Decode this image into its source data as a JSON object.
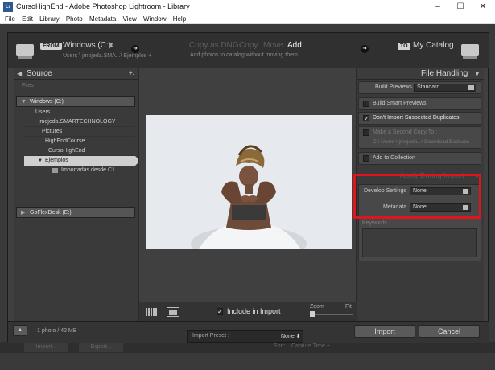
{
  "window": {
    "app_icon": "Lr",
    "title": "CursoHighEnd - Adobe Photoshop Lightroom - Library",
    "controls": {
      "minimize": "–",
      "maximize": "☐",
      "close": "✕"
    }
  },
  "menu": [
    "File",
    "Edit",
    "Library",
    "Photo",
    "Metadata",
    "View",
    "Window",
    "Help"
  ],
  "import_header": {
    "from_tag": "FROM",
    "source_name": "Windows (C:)",
    "source_caret": "⬍",
    "source_path": "Users \\ jmojeda.SMA...\\ Ejemplos +",
    "left_arrow": "➜",
    "modes": [
      "Copy as DNG",
      "Copy",
      "Move",
      "Add"
    ],
    "selected_mode": "Add",
    "mode_description": "Add photos to catalog without moving them",
    "right_arrow": "➜",
    "to_tag": "TO",
    "destination": "My Catalog"
  },
  "source_panel": {
    "header": "Source",
    "plus": "+.",
    "files_label": "Files",
    "volumes": [
      {
        "label": "Windows (C:)",
        "expanded": true
      },
      {
        "label": "GoFlexDesk (E:)",
        "expanded": false
      }
    ],
    "tree": [
      {
        "label": "Users",
        "level": 1
      },
      {
        "label": "jmojeda.SMARTECHNOLOGY",
        "level": 2
      },
      {
        "label": "Pictures",
        "level": 3
      },
      {
        "label": "HighEndCourse",
        "level": 4
      },
      {
        "label": "CursoHighEnd",
        "level": 5
      },
      {
        "label": "Ejemplos",
        "level": 6,
        "selected": true
      },
      {
        "label": "Importadas desde C1",
        "level": 7
      }
    ]
  },
  "center": {
    "include_label": "Include in Import",
    "include_checked": true,
    "zoom_label": "Zoom",
    "fit_label": "Fit"
  },
  "file_handling": {
    "header": "File Handling",
    "build_previews_label": "Build Previews",
    "build_previews_value": "Standard",
    "build_smart_previews": "Build Smart Previews",
    "dont_import_duplicates": "Don't Import Suspected Duplicates",
    "second_copy_label": "Make a Second Copy To :",
    "second_copy_path": "C:\\ Users \\ jmojeda...\\ Download Backups",
    "add_to_collection": "Add to Collection"
  },
  "apply_during_import": {
    "header": "Apply During Import",
    "develop_settings_label": "Develop Settings",
    "develop_settings_value": "None",
    "metadata_label": "Metadata",
    "metadata_value": "None",
    "keywords_label": "Keywords"
  },
  "bottom": {
    "photo_count": "1 photo / 42 MB",
    "preset_label": "Import Preset :",
    "preset_value": "None ⬍",
    "import_button": "Import",
    "cancel_button": "Cancel"
  },
  "back_toolbar": {
    "import_btn": "Import...",
    "export_btn": "Export...",
    "sort_label": "Sort:",
    "sort_value": "Capture Time ÷"
  },
  "colors": {
    "highlight": "#e0141b"
  }
}
